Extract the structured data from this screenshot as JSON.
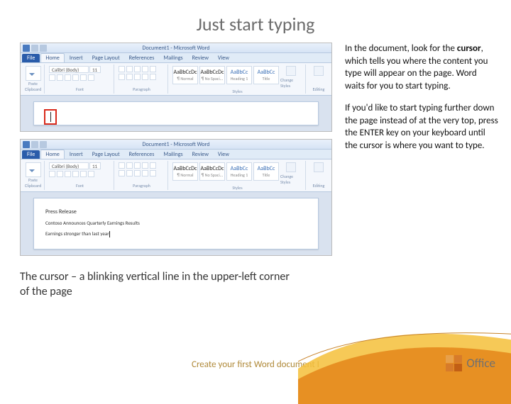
{
  "title": "Just start typing",
  "paragraphs": {
    "p1_pre": "In the document, look for the ",
    "p1_bold": "cursor",
    "p1_post": ", which tells you where the content you type will appear on the page. Word waits for you to start typing.",
    "p2": "If you'd like to start typing further down the page instead of at the very top, press the ENTER key on your keyboard until the cursor is where you want to type."
  },
  "caption": "The cursor – a blinking vertical line in the upper-left corner of the page",
  "footer": "Create your first Word document I",
  "logo_text": "Office",
  "word_mock": {
    "titlebar": "Document1 - Microsoft Word",
    "file_tab": "File",
    "tabs": [
      "Home",
      "Insert",
      "Page Layout",
      "References",
      "Mailings",
      "Review",
      "View"
    ],
    "groups": {
      "clipboard": "Clipboard",
      "font": "Font",
      "paragraph": "Paragraph",
      "styles": "Styles",
      "editing": "Editing"
    },
    "font_name": "Calibri (Body)",
    "font_size": "11",
    "paste": "Paste",
    "style_items": [
      {
        "sample": "AaBbCcDc",
        "label": "¶ Normal"
      },
      {
        "sample": "AaBbCcDc",
        "label": "¶ No Spaci..."
      },
      {
        "sample": "AaBbCc",
        "label": "Heading 1"
      },
      {
        "sample": "AaBbCc",
        "label": "Title"
      }
    ],
    "change_styles": "Change Styles",
    "doc2_lines": {
      "l1": "Press Release",
      "l2": "Contoso Announces Quarterly Earnings Results",
      "l3": "Earnings stronger than last year"
    }
  }
}
